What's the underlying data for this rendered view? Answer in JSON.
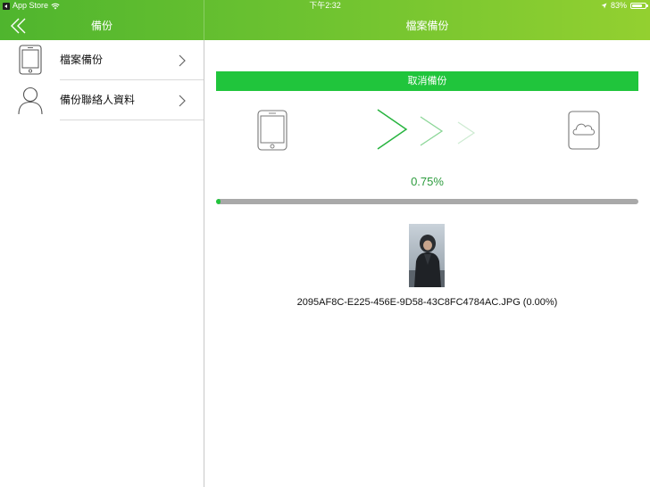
{
  "status": {
    "carrier": "App Store",
    "time": "下午2:32",
    "battery": "83%",
    "battery_level": 0.83
  },
  "sidebar": {
    "title": "備份",
    "items": [
      {
        "label": "檔案備份",
        "icon": "phone-icon"
      },
      {
        "label": "備份聯絡人資料",
        "icon": "person-icon"
      }
    ]
  },
  "main": {
    "title": "檔案備份",
    "cancel_label": "取消備份",
    "progress_text": "0.75%",
    "progress_value": 0.0075,
    "file_label": "2095AF8C-E225-456E-9D58-43C8FC4784AC.JPG (0.00%)"
  },
  "colors": {
    "accent": "#20c53c",
    "progress_text": "#2d9c3e",
    "track": "#a9a9a9",
    "header_start": "#4fb52e",
    "header_end": "#93d030"
  }
}
